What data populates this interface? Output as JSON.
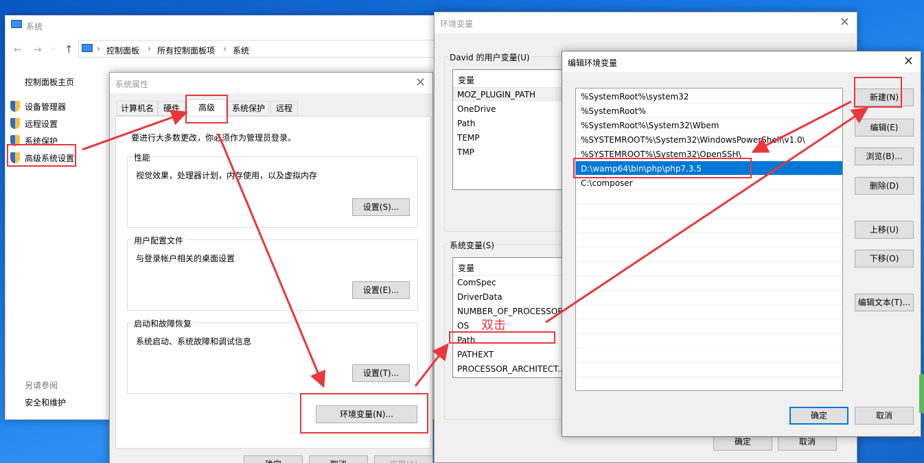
{
  "system_window": {
    "title": "系统",
    "breadcrumb": [
      "控制面板",
      "所有控制面板项",
      "系统"
    ],
    "sidebar": {
      "home": "控制面板主页",
      "items": [
        "设备管理器",
        "远程设置",
        "系统保护",
        "高级系统设置"
      ],
      "see_also_title": "另请参阅",
      "see_also_items": [
        "安全和维护"
      ]
    }
  },
  "sysprop": {
    "title": "系统属性",
    "tabs": [
      "计算机名",
      "硬件",
      "高级",
      "系统保护",
      "远程"
    ],
    "admin_note": "要进行大多数更改，你必须作为管理员登录。",
    "performance": {
      "label": "性能",
      "desc": "视觉效果，处理器计划，内存使用，以及虚拟内存",
      "button": "设置(S)..."
    },
    "profile": {
      "label": "用户配置文件",
      "desc": "与登录帐户相关的桌面设置",
      "button": "设置(E)..."
    },
    "startup": {
      "label": "启动和故障恢复",
      "desc": "系统启动、系统故障和调试信息",
      "button": "设置(T)..."
    },
    "env_button": "环境变量(N)...",
    "footer_buttons": [
      "确定",
      "取消",
      "应用(A)"
    ]
  },
  "envvars": {
    "title": "环境变量",
    "user_group": "David 的用户变量(U)",
    "user_header": "变量",
    "user_vars": [
      "MOZ_PLUGIN_PATH",
      "OneDrive",
      "Path",
      "TEMP",
      "TMP"
    ],
    "sys_group": "系统变量(S)",
    "sys_header": "变量",
    "sys_vars": [
      "ComSpec",
      "DriverData",
      "NUMBER_OF_PROCESSOR",
      "OS",
      "Path",
      "PATHEXT",
      "PROCESSOR_ARCHITECT..."
    ],
    "ok": "确定",
    "cancel": "取消"
  },
  "edit_env": {
    "title": "编辑环境变量",
    "entries": [
      "%SystemRoot%\\system32",
      "%SystemRoot%",
      "%SystemRoot%\\System32\\Wbem",
      "%SYSTEMROOT%\\System32\\WindowsPowerShell\\v1.0\\",
      "%SYSTEMROOT%\\System32\\OpenSSH\\",
      "D:\\wamp64\\bin\\php\\php7.3.5",
      "C:\\composer"
    ],
    "selected_index": 5,
    "buttons": {
      "new": "新建(N)",
      "edit": "编辑(E)",
      "browse": "浏览(B)...",
      "delete": "删除(D)",
      "up": "上移(U)",
      "down": "下移(O)",
      "edit_text": "编辑文本(T)..."
    },
    "ok": "确定",
    "cancel": "取消"
  },
  "annotation": {
    "text": "双击",
    "color": "#e8383b"
  },
  "colors": {
    "selection": "#0078d7",
    "annotation": "#e8383b",
    "accent": "#0078d7"
  }
}
